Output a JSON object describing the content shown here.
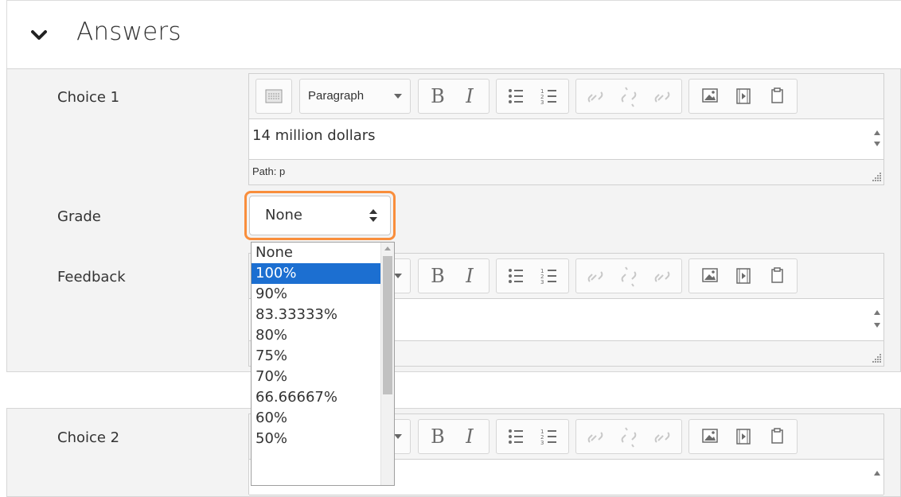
{
  "section": {
    "title": "Answers"
  },
  "choice1": {
    "label": "Choice 1",
    "toolbar": {
      "paragraph_label": "Paragraph"
    },
    "content": "14 million dollars",
    "path": "Path: p"
  },
  "grade": {
    "label": "Grade",
    "value": "None",
    "options": [
      "None",
      "100%",
      "90%",
      "83.33333%",
      "80%",
      "75%",
      "70%",
      "66.66667%",
      "60%",
      "50%"
    ],
    "highlighted": "100%"
  },
  "feedback": {
    "label": "Feedback"
  },
  "choice2": {
    "label": "Choice 2"
  },
  "colors": {
    "focus_ring": "#f98e3c",
    "selection": "#1c6fd1"
  }
}
